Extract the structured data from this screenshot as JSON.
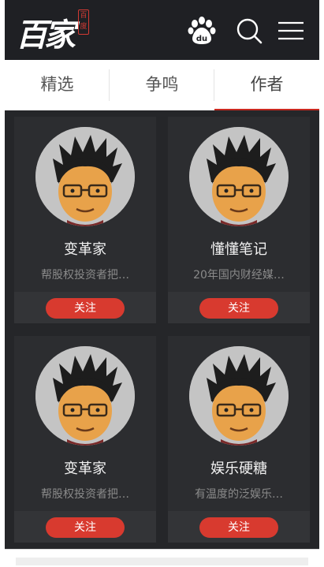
{
  "header": {
    "logo_text": "百家",
    "logo_stamp": "百度",
    "icons": [
      "baidu-paw-icon",
      "search-icon",
      "menu-icon"
    ]
  },
  "tabs": [
    {
      "label": "精选"
    },
    {
      "label": "争鸣"
    },
    {
      "label": "作者",
      "active": true
    }
  ],
  "authors": [
    {
      "name": "变革家",
      "desc": "帮股权投资者把…",
      "button": "关注"
    },
    {
      "name": "懂懂笔记",
      "desc": "20年国内财经媒…",
      "button": "关注"
    },
    {
      "name": "变革家",
      "desc": "帮股权投资者把…",
      "button": "关注"
    },
    {
      "name": "娱乐硬糖",
      "desc": "有温度的泛娱乐…",
      "button": "关注"
    }
  ],
  "colors": {
    "header_bg": "#1f2024",
    "accent_red": "#d83a2f",
    "grid_bg": "#252629",
    "card_bg": "#2c2d30"
  }
}
